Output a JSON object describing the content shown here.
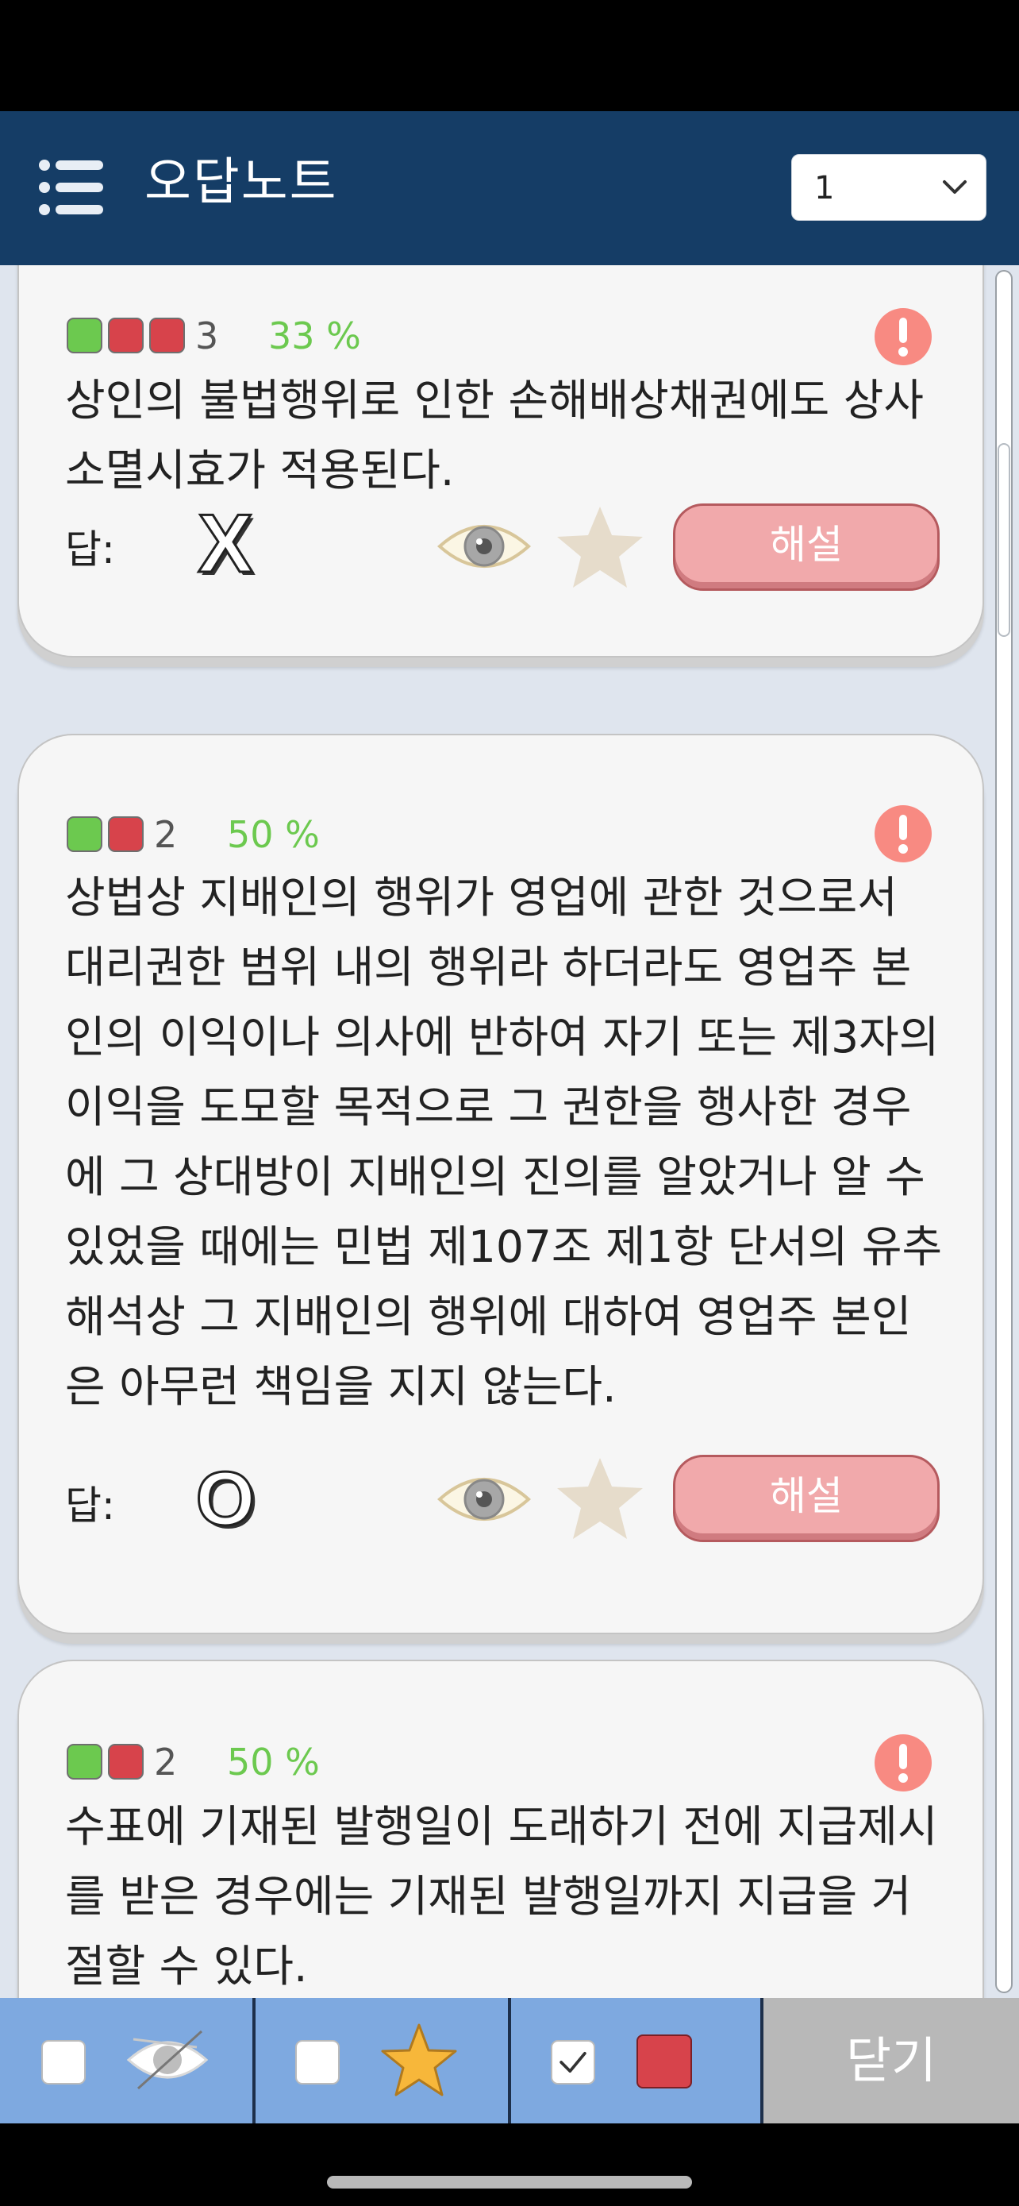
{
  "header": {
    "title": "오답노트",
    "page_select_value": "1"
  },
  "cards": [
    {
      "count": "3",
      "percent": "33 %",
      "text_lines": [
        "상인의 불법행위로 인한 손해배상채권에도 상사",
        "소멸시효가 적용된다."
      ],
      "answer_label": "답:",
      "answer": "X",
      "explain_label": "해설"
    },
    {
      "count": "2",
      "percent": "50 %",
      "text_lines": [
        "상법상 지배인의 행위가 영업에 관한 것으로서",
        "대리권한 범위 내의 행위라 하더라도 영업주 본",
        "인의 이익이나 의사에 반하여 자기 또는 제3자의",
        "이익을 도모할 목적으로 그 권한을 행사한 경우",
        "에 그 상대방이 지배인의 진의를 알았거나 알 수",
        "있었을 때에는 민법 제107조 제1항 단서의 유추",
        "해석상 그 지배인의 행위에 대하여 영업주 본인",
        "은 아무런 책임을 지지 않는다."
      ],
      "answer_label": "답:",
      "answer": "O",
      "explain_label": "해설"
    },
    {
      "count": "2",
      "percent": "50 %",
      "text_lines": [
        "수표에 기재된 발행일이 도래하기 전에 지급제시",
        "를 받은 경우에는 기재된 발행일까지 지급을 거",
        "절할 수 있다."
      ]
    }
  ],
  "filters": {
    "hide_viewed_checked": false,
    "starred_checked": false,
    "wrong_checked": true
  },
  "close_label": "닫기",
  "colors": {
    "header_bg": "#153d66",
    "correct_green": "#6cc94f",
    "wrong_red": "#d7434b",
    "explain_btn": "#f1a9ab",
    "filter_bg": "#7ea9e0"
  },
  "icons": [
    "menu-icon",
    "chevron-down-icon",
    "alert-icon",
    "eye-icon",
    "star-icon",
    "hidden-eye-icon"
  ]
}
